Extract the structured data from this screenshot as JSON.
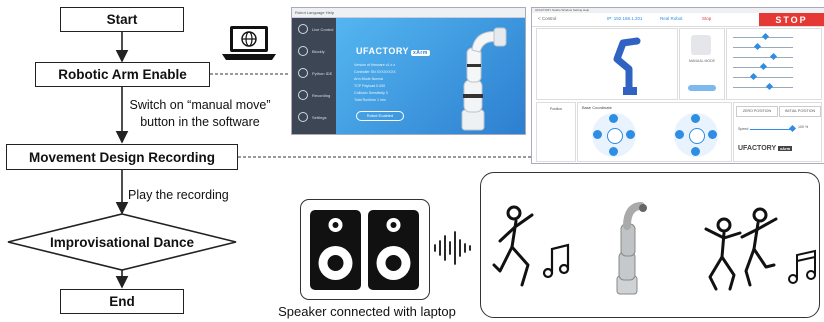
{
  "flowchart": {
    "start": "Start",
    "enable": "Robotic Arm Enable",
    "recording": "Movement Design Recording",
    "dance": "Improvisational Dance",
    "end": "End",
    "switch_note_line1": "Switch on “manual move”",
    "switch_note_line2": "button in the software",
    "play_note": "Play the recording"
  },
  "speaker": {
    "caption": "Speaker connected with laptop"
  },
  "screenshot_enable": {
    "menu": "Robot  Language  Help",
    "sidebar": [
      "Live Control",
      "Blockly",
      "Python IDE",
      "Recording",
      "Settings"
    ],
    "brand": "UFACTORY",
    "brand_tag": "xArm",
    "info_rows": [
      "Version of firmware   v1.x.x",
      "Controller SN   XXXXXXXX",
      "Arm Mode   Normal",
      "TCP Payload   0.000",
      "Collision Sensitivity   3",
      "Total Runtime   1 min"
    ],
    "button": "Robot Enabled"
  },
  "screenshot_live": {
    "title": "UFACTORY Studio",
    "menu": "Window  Setting  Help",
    "back": "< Control",
    "status_items": [
      "IP: 192.168.1.201",
      "Real Robot",
      "Stop"
    ],
    "stop": "STOP",
    "manual_mode": "MANUAL MODE",
    "base_coord": "Base Coordinate",
    "position_label": "Position",
    "zero_position": "ZERO POSITION",
    "initial_position": "INITIAL POSITION",
    "speed_label": "Speed",
    "speed_value": "100 %",
    "brand": "UFACTORY",
    "brand_tag": "xArm"
  },
  "colors": {
    "arrow": "#222222",
    "accent_blue": "#2f8de4",
    "stop_red": "#e53935"
  },
  "icons": [
    "laptop-globe-icon",
    "speaker-icon",
    "sound-wave-icon",
    "dancer-icon",
    "music-note-icon",
    "robot-arm-icon",
    "dancing-couple-icon",
    "double-note-icon"
  ]
}
